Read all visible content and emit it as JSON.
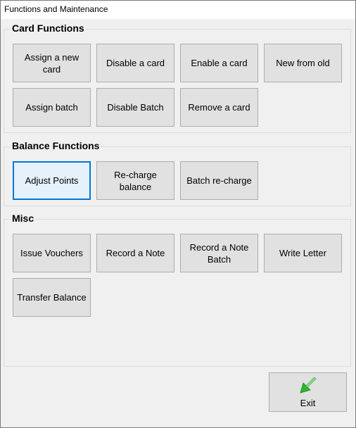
{
  "window": {
    "title": "Functions and Maintenance"
  },
  "card_functions": {
    "label": "Card Functions",
    "buttons": [
      "Assign a new card",
      "Disable a card",
      "Enable a card",
      "New from old",
      "Assign batch",
      "Disable Batch",
      "Remove a card"
    ]
  },
  "balance_functions": {
    "label": "Balance Functions",
    "buttons": [
      "Adjust Points",
      "Re-charge balance",
      "Batch re-charge"
    ]
  },
  "misc": {
    "label": "Misc",
    "buttons": [
      "Issue Vouchers",
      "Record a Note",
      "Record a Note Batch",
      "Write Letter",
      "Transfer Balance"
    ]
  },
  "exit": {
    "label": "Exit",
    "icon": "green-arrow-exit-icon"
  },
  "colors": {
    "focus_border": "#0078d7",
    "button_bg": "#e1e1e1",
    "icon_green": "#2fb52f"
  }
}
